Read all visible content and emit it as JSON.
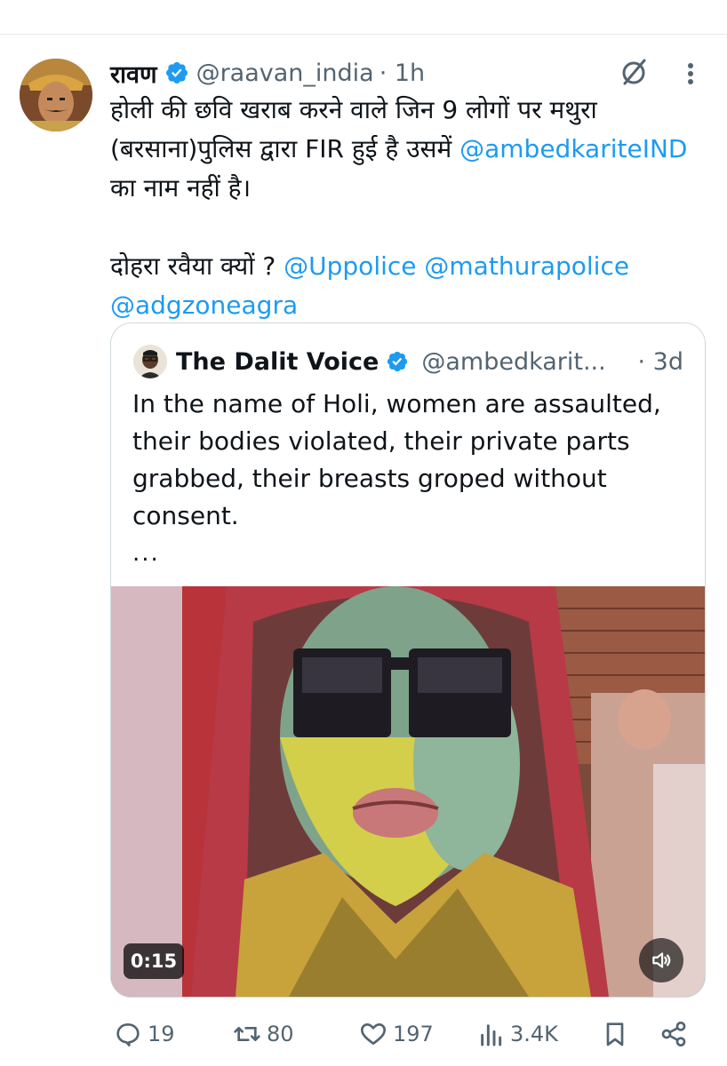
{
  "tweet": {
    "author_name": "रावण",
    "author_handle": "@raavan_india",
    "time": "· 1h",
    "text": {
      "line1": "होली की छवि खराब करने वाले जिन 9 लोगों पर मथुरा (बरसाना)पुलिस द्वारा FIR हुई है उसमें ",
      "mention1": "@ambedkariteIND",
      "line1_end": " का नाम नहीं है।",
      "line2": "दोहरा रवैया क्यों ? ",
      "mention2": "@Uppolice",
      "space": " ",
      "mention3": "@mathurapolice",
      "mention4": "@adgzoneagra"
    }
  },
  "quoted": {
    "author_name": "The Dalit Voice",
    "author_handle": "@ambedkarit...",
    "time": "· 3d",
    "text": "In the name of Holi, women are assaulted, their bodies violated, their private parts grabbed, their breasts groped without consent.",
    "ellipsis": "...",
    "video_duration": "0:15"
  },
  "actions": {
    "replies": "19",
    "reposts": "80",
    "likes": "197",
    "views": "3.4K"
  },
  "colors": {
    "link": "#1d9bf0",
    "secondary_text": "#536471",
    "border": "#cfd9de"
  },
  "icons": [
    "verified-badge-icon",
    "grok-icon",
    "more-icon",
    "reply-icon",
    "repost-icon",
    "like-icon",
    "views-icon",
    "bookmark-icon",
    "share-icon",
    "volume-icon"
  ]
}
